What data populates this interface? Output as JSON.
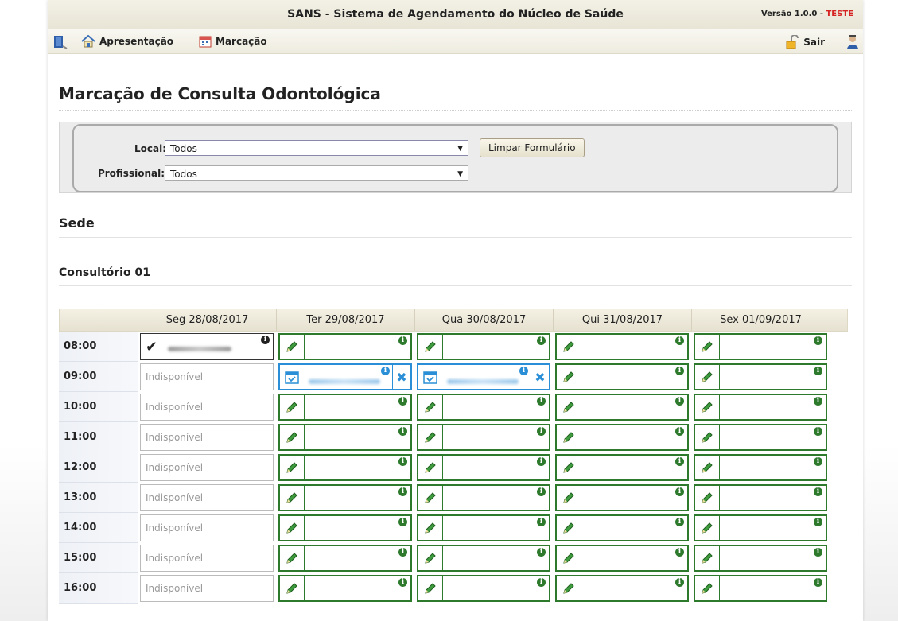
{
  "header": {
    "title": "SANS - Sistema de Agendamento do Núcleo de Saúde",
    "version_prefix": "Versão 1.0.0 - ",
    "version_env": "TESTE"
  },
  "nav": {
    "apresentacao": "Apresentação",
    "marcacao": "Marcação",
    "sair": "Sair"
  },
  "page": {
    "title": "Marcação de Consulta Odontológica"
  },
  "filters": {
    "local_label": "Local:",
    "local_value": "Todos",
    "profissional_label": "Profissional:",
    "profissional_value": "Todos",
    "clear_button": "Limpar Formulário"
  },
  "sections": {
    "place": "Sede",
    "room": "Consultório 01"
  },
  "schedule": {
    "days": [
      "Seg 28/08/2017",
      "Ter 29/08/2017",
      "Qua 30/08/2017",
      "Qui 31/08/2017",
      "Sex 01/09/2017"
    ],
    "times": [
      "08:00",
      "09:00",
      "10:00",
      "11:00",
      "12:00",
      "13:00",
      "14:00",
      "15:00",
      "16:00"
    ],
    "unavailable_label": "Indisponível",
    "info_glyph": "i"
  }
}
